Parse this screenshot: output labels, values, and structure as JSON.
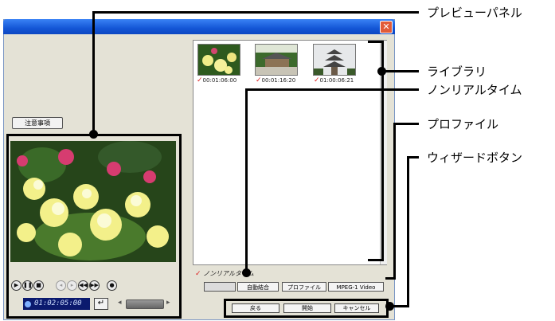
{
  "window": {
    "close_glyph": "✕",
    "notice_button": "注意事項"
  },
  "preview": {
    "timecode": "01:02:05:00",
    "enter_glyph": "↵",
    "controls": [
      "play-icon",
      "pause-icon",
      "stop-icon",
      "prev-frame-icon",
      "next-frame-icon",
      "rewind-icon",
      "fast-forward-icon",
      "mark-icon"
    ]
  },
  "library": {
    "items": [
      {
        "timecode": "00:01:06:00",
        "checked": true,
        "subject": "flowers"
      },
      {
        "timecode": "00:01:16:20",
        "checked": true,
        "subject": "temple"
      },
      {
        "timecode": "01:00:06:21",
        "checked": true,
        "subject": "pagoda"
      }
    ],
    "check_glyph": "✓"
  },
  "nonrealtime": {
    "label": "ノンリアルタイム"
  },
  "profile_row": {
    "auto_join": "自動結合",
    "profile": "プロファイル",
    "mpeg_label": "MPEG-1 Video"
  },
  "wizard": {
    "back": "戻る",
    "start": "開始",
    "cancel": "キャンセル"
  },
  "callouts": {
    "preview_panel": "プレビューパネル",
    "library": "ライブラリ",
    "nonrealtime": "ノンリアルタイム",
    "profile": "プロファイル",
    "wizard_button": "ウィザードボタン"
  }
}
